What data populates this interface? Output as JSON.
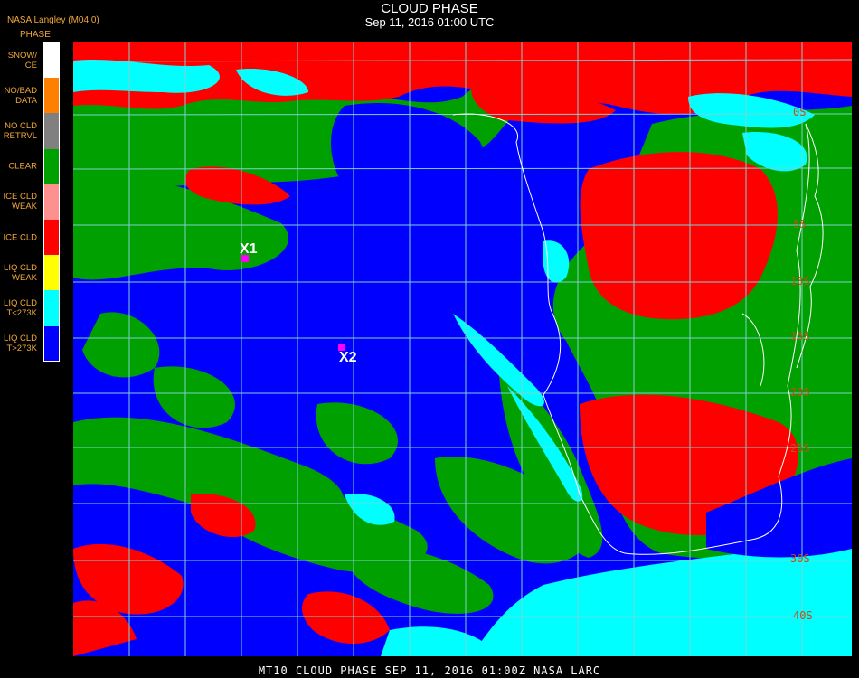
{
  "header": {
    "title": "CLOUD PHASE",
    "subtitle": "Sep 11, 2016 01:00 UTC",
    "source": "NASA Langley (M04.0)"
  },
  "legend": {
    "title": "PHASE",
    "items": [
      {
        "label": "SNOW/\nICE",
        "color": "#ffffff"
      },
      {
        "label": "NO/BAD\nDATA",
        "color": "#ff8000"
      },
      {
        "label": "NO CLD\nRETRVL",
        "color": "#808080"
      },
      {
        "label": "CLEAR",
        "color": "#00a000"
      },
      {
        "label": "ICE CLD\nWEAK",
        "color": "#ff9090"
      },
      {
        "label": "ICE CLD",
        "color": "#ff0000"
      },
      {
        "label": "LIQ CLD\nWEAK",
        "color": "#ffff00"
      },
      {
        "label": "LIQ CLD\nT<273K",
        "color": "#00ffff"
      },
      {
        "label": "LIQ CLD\nT>273K",
        "color": "#0000ff"
      }
    ]
  },
  "map": {
    "colors": {
      "ocean_liquid": "#0000ff",
      "clear": "#00a000",
      "ice": "#ff0000",
      "cold_liquid": "#00ffff",
      "grid": "#7fd0d0",
      "coast": "#ffffff"
    },
    "lat_labels": [
      "0S",
      "5S",
      "10S",
      "15S",
      "20S",
      "25S",
      "30S",
      "40S"
    ],
    "markers": [
      {
        "label": "X1",
        "color": "#ff00ff"
      },
      {
        "label": "X2",
        "color": "#ff00ff"
      }
    ]
  },
  "footer": "MT10   CLOUD PHASE   SEP 11, 2016 01:00Z   NASA LARC"
}
